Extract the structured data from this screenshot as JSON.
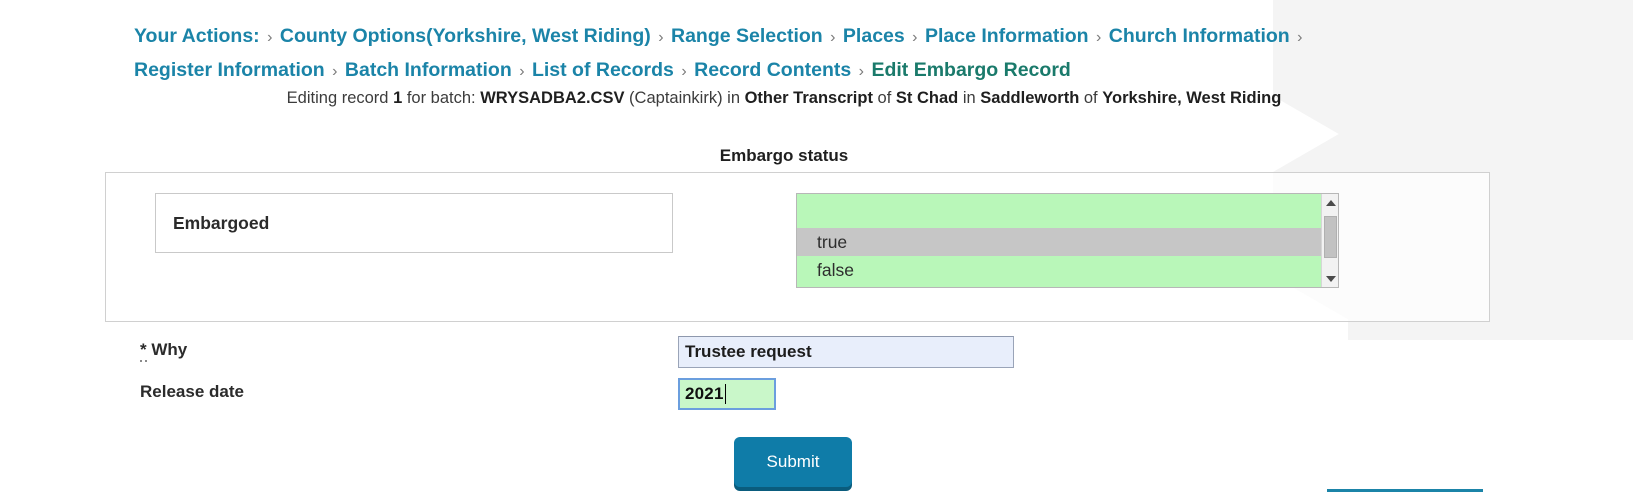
{
  "breadcrumb": {
    "prefix": "Your Actions:",
    "separator": "›",
    "items": [
      {
        "label": "County Options(Yorkshire, West Riding)",
        "current": false
      },
      {
        "label": "Range Selection",
        "current": false
      },
      {
        "label": "Places",
        "current": false
      },
      {
        "label": "Place Information",
        "current": false
      },
      {
        "label": "Church Information",
        "current": false
      },
      {
        "label": "Register Information",
        "current": false
      },
      {
        "label": "Batch Information",
        "current": false
      },
      {
        "label": "List of Records",
        "current": false
      },
      {
        "label": "Record Contents",
        "current": false
      },
      {
        "label": "Edit Embargo Record",
        "current": true
      }
    ]
  },
  "record_line": {
    "t1": "Editing record ",
    "record_number": "1",
    "t2": " for batch: ",
    "batch_name": "WRYSADBA2.CSV",
    "t3": " (Captainkirk) in ",
    "record_type": "Other Transcript",
    "t4": " of ",
    "church": "St Chad",
    "t5": " in ",
    "place": "Saddleworth",
    "t6": " of ",
    "county": "Yorkshire, West Riding"
  },
  "embargo_section": {
    "legend": "Embargo status",
    "status_name": "Embargoed",
    "options": [
      {
        "label": "true",
        "selected": true
      },
      {
        "label": "false",
        "selected": false
      }
    ],
    "listbox_background": "#b9f7b9",
    "selected_background": "#c6c6c6"
  },
  "fields": {
    "why": {
      "required_marker": "*",
      "label": "Why",
      "value": "Trustee request",
      "placeholder": "",
      "background": "#e8eefb"
    },
    "release_date": {
      "label": "Release date",
      "value": "2021",
      "placeholder": "",
      "background": "#c9f7c9",
      "focused": true
    }
  },
  "submit": {
    "label": "Submit",
    "color": "#0f7ca8"
  },
  "theme": {
    "link_color": "#1b84a8",
    "current_crumb_color": "#1a7a6b",
    "page_background": "#ffffff"
  }
}
